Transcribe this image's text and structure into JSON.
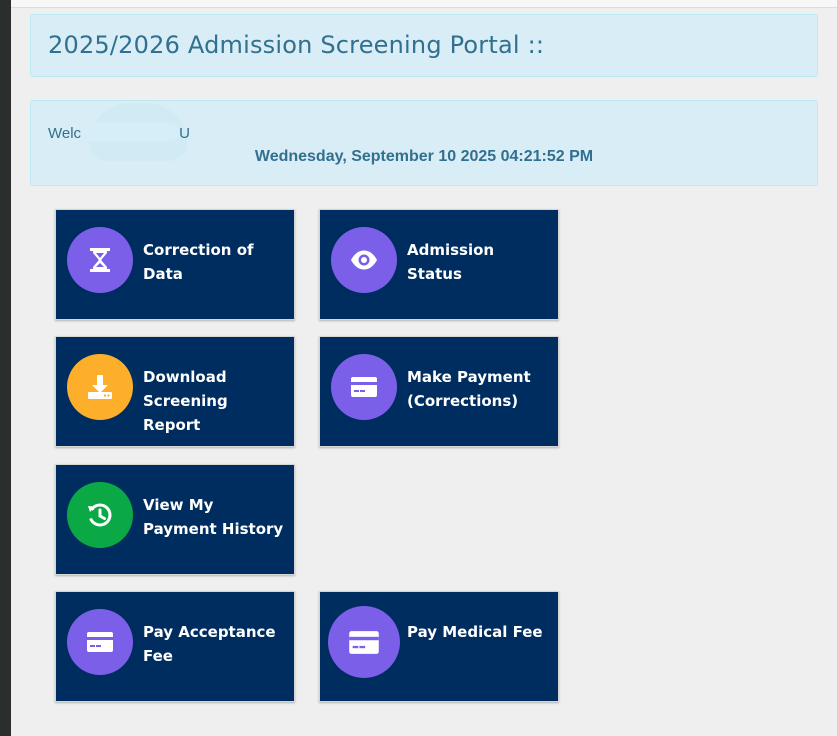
{
  "header": {
    "title": "2025/2026 Admission Screening Portal ::"
  },
  "welcome": {
    "prefix": "Welc",
    "suffix": "U",
    "datetime": "Wednesday, September 10 2025 04:21:52 PM"
  },
  "tiles": [
    {
      "label": "Correction of Data",
      "icon": "hourglass-icon",
      "color": "#7b5fe8"
    },
    {
      "label": "Admission Status",
      "icon": "eye-icon",
      "color": "#7b5fe8"
    },
    {
      "label": "Download Screening Report",
      "icon": "download-icon",
      "color": "#fdae2b"
    },
    {
      "label": "Make Payment (Corrections)",
      "icon": "credit-card-icon",
      "color": "#7b5fe8"
    },
    {
      "label": "View My Payment History",
      "icon": "history-icon",
      "color": "#0aa945"
    },
    {
      "label": "Pay Acceptance Fee",
      "icon": "credit-card-icon",
      "color": "#7b5fe8"
    },
    {
      "label": "Pay Medical Fee",
      "icon": "credit-card-icon",
      "color": "#7b5fe8"
    }
  ],
  "colors": {
    "tile_background": "#002d5f",
    "panel_background": "#d9edf7",
    "panel_text": "#31708f"
  }
}
